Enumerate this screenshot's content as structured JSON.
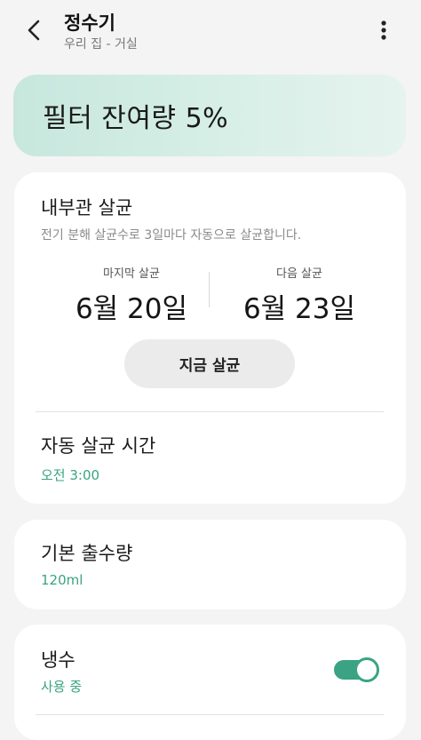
{
  "header": {
    "title": "정수기",
    "subtitle": "우리 집 - 거실"
  },
  "banner": {
    "text": "필터 잔여량 5%"
  },
  "sanitize": {
    "title": "내부관 살균",
    "description": "전기 분해 살균수로 3일마다 자동으로 살균합니다.",
    "last_label": "마지막 살균",
    "last_value": "6월 20일",
    "next_label": "다음 살균",
    "next_value": "6월 23일",
    "button_label": "지금 살균",
    "auto_time_title": "자동 살균 시간",
    "auto_time_value": "오전 3:00"
  },
  "dispense": {
    "title": "기본 출수량",
    "value": "120ml"
  },
  "cold_water": {
    "title": "냉수",
    "status": "사용 중",
    "enabled": true
  },
  "colors": {
    "accent": "#3aa383",
    "banner": "#c7e7dd",
    "background": "#f4f4f4"
  },
  "icons": {
    "back": "chevron-left-icon",
    "more": "more-vertical-icon"
  }
}
